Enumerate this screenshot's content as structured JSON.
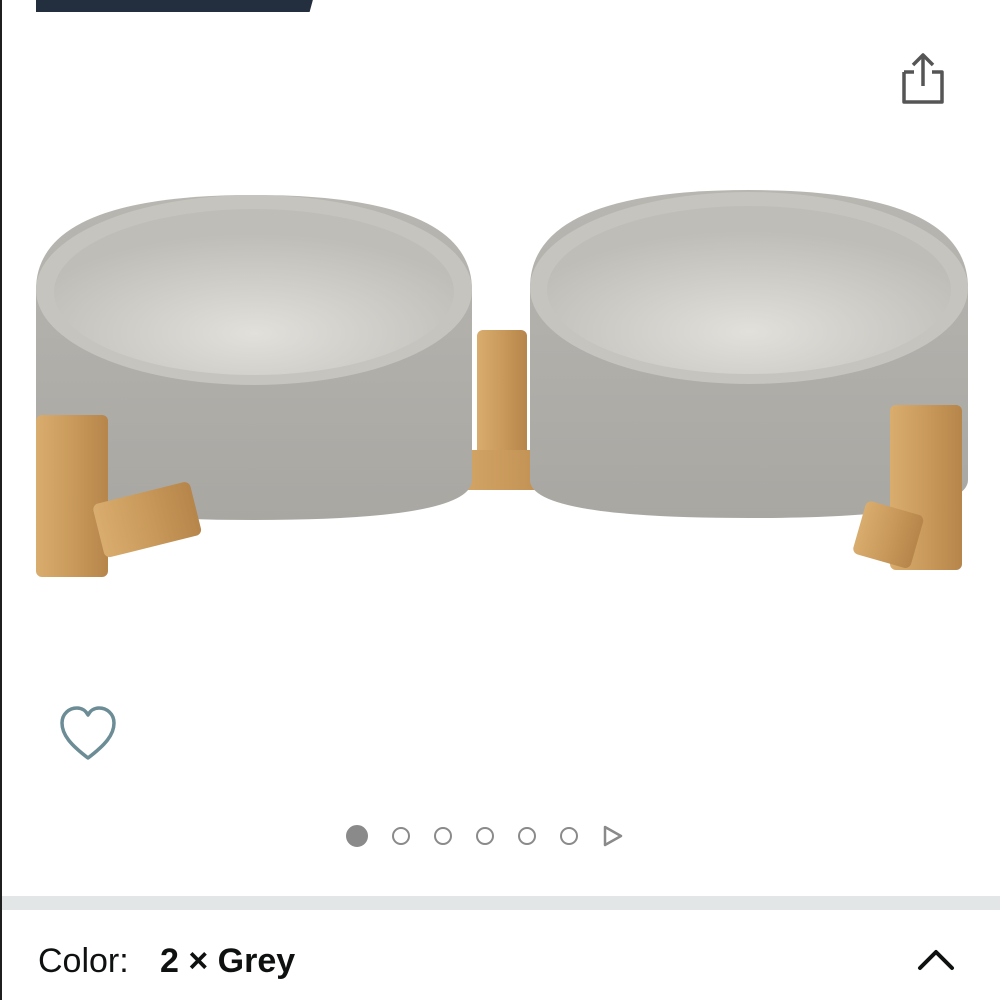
{
  "icons": {
    "share": "share-icon",
    "wishlist": "heart-outline-icon",
    "carousel_next": "play-triangle-icon",
    "collapse": "chevron-up-icon"
  },
  "colors": {
    "brand_dark": "#232f3e",
    "bowl_grey": "#b3b1ac",
    "bamboo": "#c99a5b",
    "divider": "#e3e6e6",
    "text": "#0f1111",
    "dot": "#8a8a8a"
  },
  "carousel": {
    "total_dots": 6,
    "active_index": 0
  },
  "variation": {
    "label": "Color:",
    "value": "2 × Grey"
  }
}
